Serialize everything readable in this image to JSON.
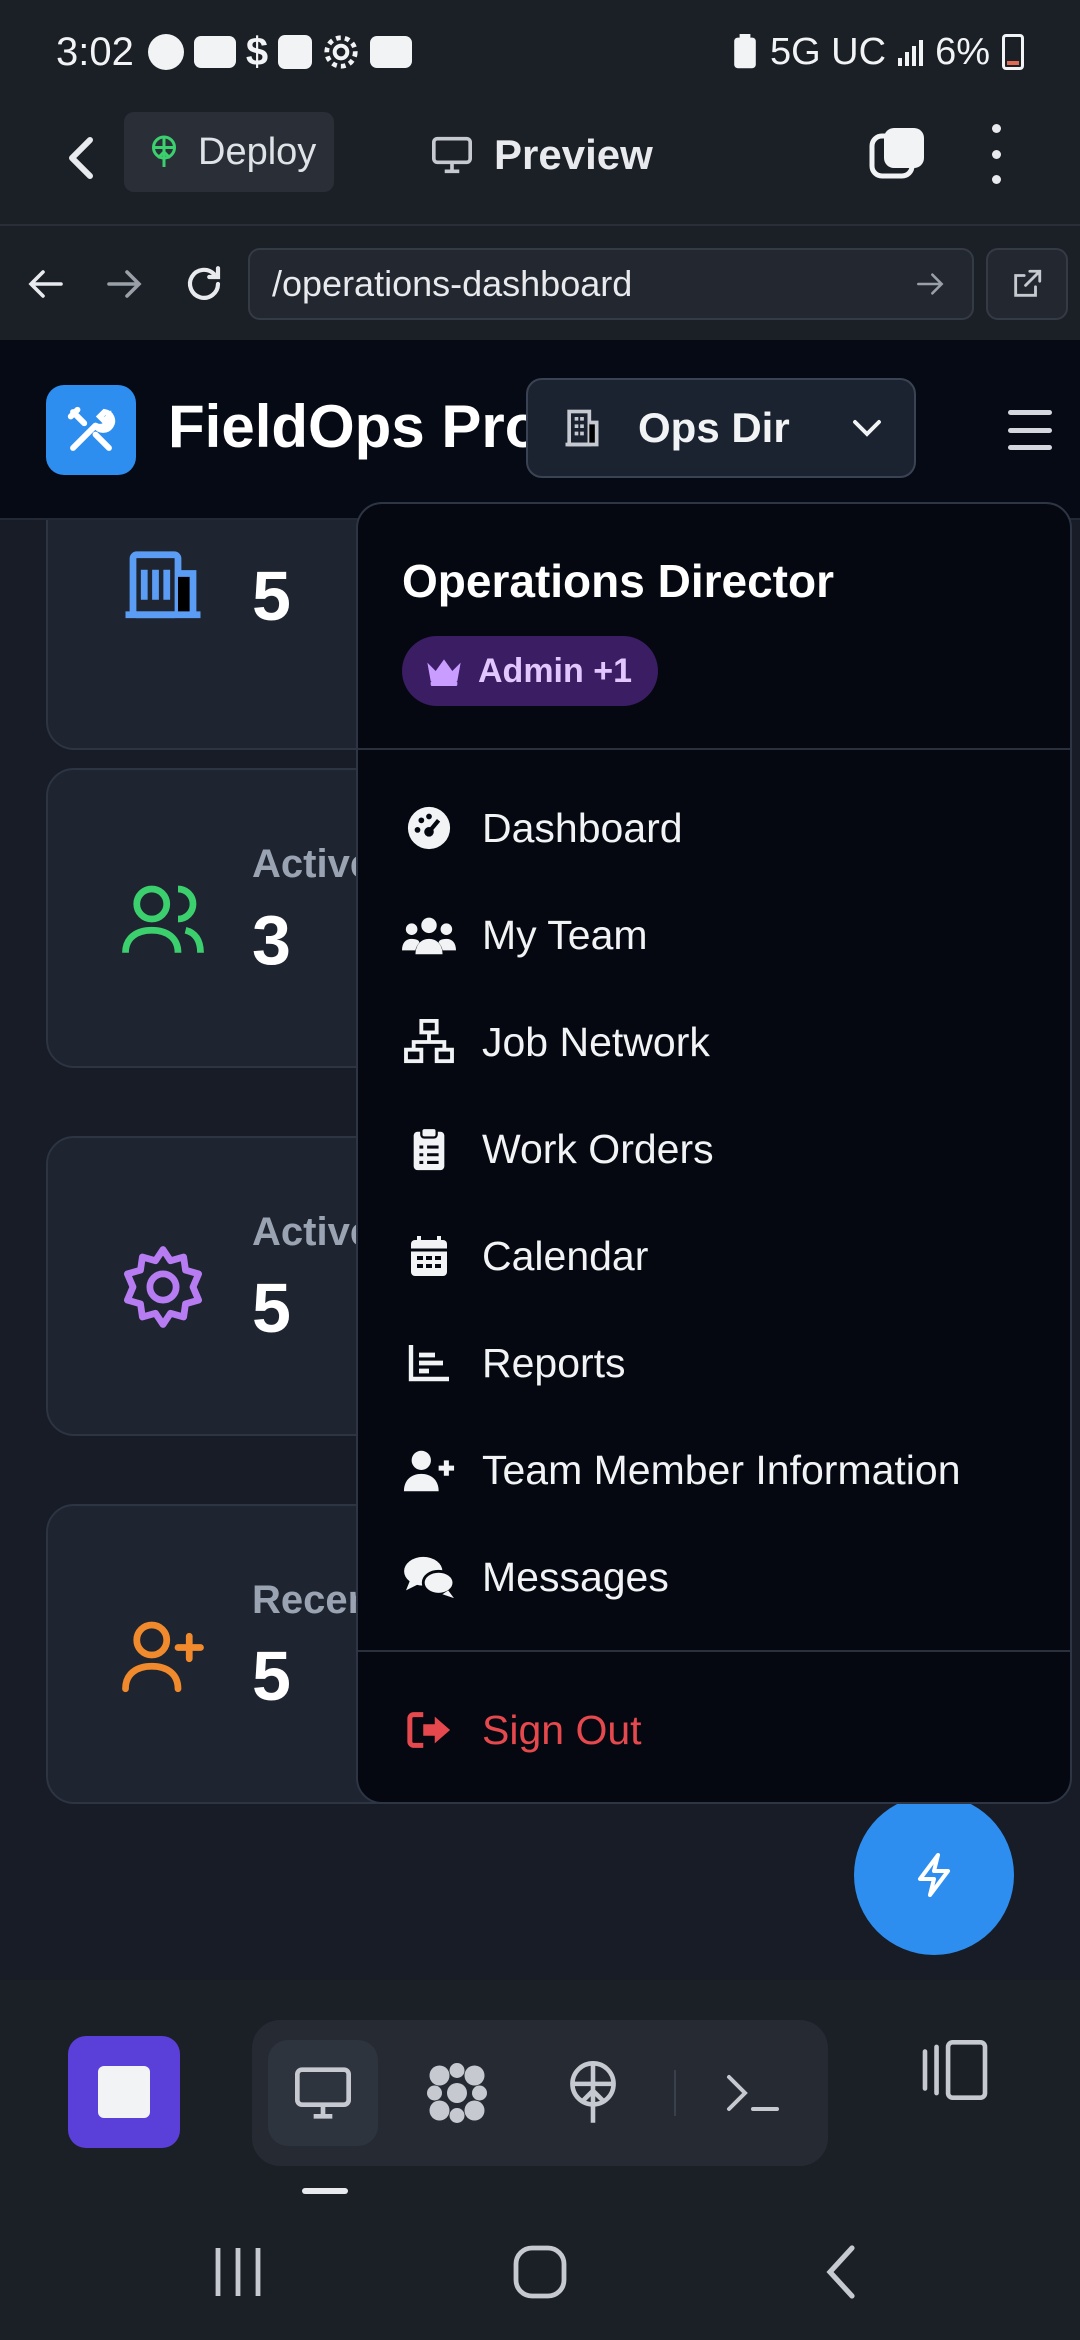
{
  "status_bar": {
    "time": "3:02",
    "network": "5G UC",
    "battery": "6%",
    "notification_icons": [
      "messenger-icon",
      "youtube-icon",
      "dollar-icon",
      "gallery-icon",
      "settings-icon",
      "youtube-icon"
    ]
  },
  "app_bar": {
    "deploy_label": "Deploy",
    "preview_label": "Preview"
  },
  "browser": {
    "url": "/operations-dashboard"
  },
  "header": {
    "brand": "FieldOps Pro",
    "role_short": "Ops Dir"
  },
  "stats": [
    {
      "label": "",
      "value": "5",
      "icon": "building-icon",
      "color": "#5b9df5"
    },
    {
      "label": "Active",
      "value": "3",
      "icon": "users-icon",
      "color": "#3ccf6e"
    },
    {
      "label": "Active",
      "value": "5",
      "icon": "gear-icon",
      "color": "#b77cf2"
    },
    {
      "label": "Recen",
      "value": "5",
      "icon": "user-plus-icon",
      "color": "#f08a2c"
    }
  ],
  "menu": {
    "title": "Operations Director",
    "badge": "Admin +1",
    "items": [
      {
        "label": "Dashboard",
        "icon": "gauge-icon"
      },
      {
        "label": "My Team",
        "icon": "team-icon"
      },
      {
        "label": "Job Network",
        "icon": "network-icon"
      },
      {
        "label": "Work Orders",
        "icon": "clipboard-icon"
      },
      {
        "label": "Calendar",
        "icon": "calendar-icon"
      },
      {
        "label": "Reports",
        "icon": "chart-icon"
      },
      {
        "label": "Team Member Information",
        "icon": "user-plus-icon"
      },
      {
        "label": "Messages",
        "icon": "chat-icon"
      }
    ],
    "sign_out": "Sign Out"
  },
  "colors": {
    "accent_blue": "#2d8ef0",
    "badge_bg": "#3a1d63",
    "danger": "#e5484d",
    "stop_purple": "#5b3fd9"
  }
}
